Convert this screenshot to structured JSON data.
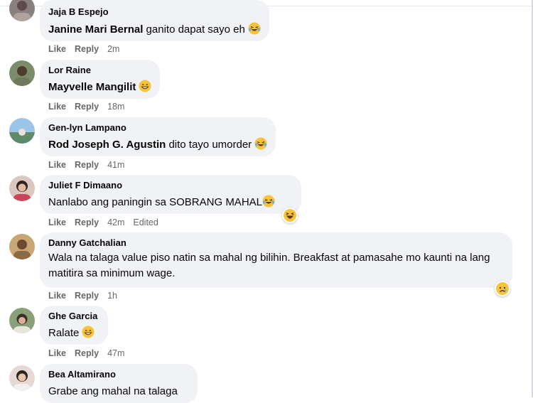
{
  "actions": {
    "like": "Like",
    "reply": "Reply"
  },
  "comments": [
    {
      "author": "Jaja B Espejo",
      "mention": "Janine Mari Bernal",
      "text": " ganito dapat sayo eh",
      "time": "2m",
      "emoji": "laughing-tears-emoji"
    },
    {
      "author": "Lor Raine",
      "mention": "Mayvelle Mangilit",
      "text": "",
      "time": "18m",
      "emoji": "grinning-emoji"
    },
    {
      "author": "Gen-lyn Lampano",
      "mention": "Rod Joseph G. Agustin",
      "text": " dito tayo umorder",
      "time": "41m",
      "emoji": "laughing-tears-emoji"
    },
    {
      "author": "Juliet F Dimaano",
      "mention": "",
      "text": "Nanlabo ang paningin sa SOBRANG MAHAL",
      "time": "42m",
      "edited": "Edited",
      "emoji": "laughing-tears-emoji",
      "reaction": "haha-reaction-icon"
    },
    {
      "author": "Danny Gatchalian",
      "mention": "",
      "text": "Wala na talaga value piso natin sa mahal ng bilihin. Breakfast at pamasahe mo kaunti na lang matitira sa minimum wage.",
      "time": "1h",
      "reaction": "sad-reaction-icon"
    },
    {
      "author": "Ghe Garcia",
      "mention": "",
      "text": "Ralate",
      "time": "47m",
      "emoji": "grinning-emoji"
    },
    {
      "author": "Bea Altamirano",
      "mention": "",
      "text": "Grabe ang mahal na talaga",
      "time": ""
    }
  ]
}
